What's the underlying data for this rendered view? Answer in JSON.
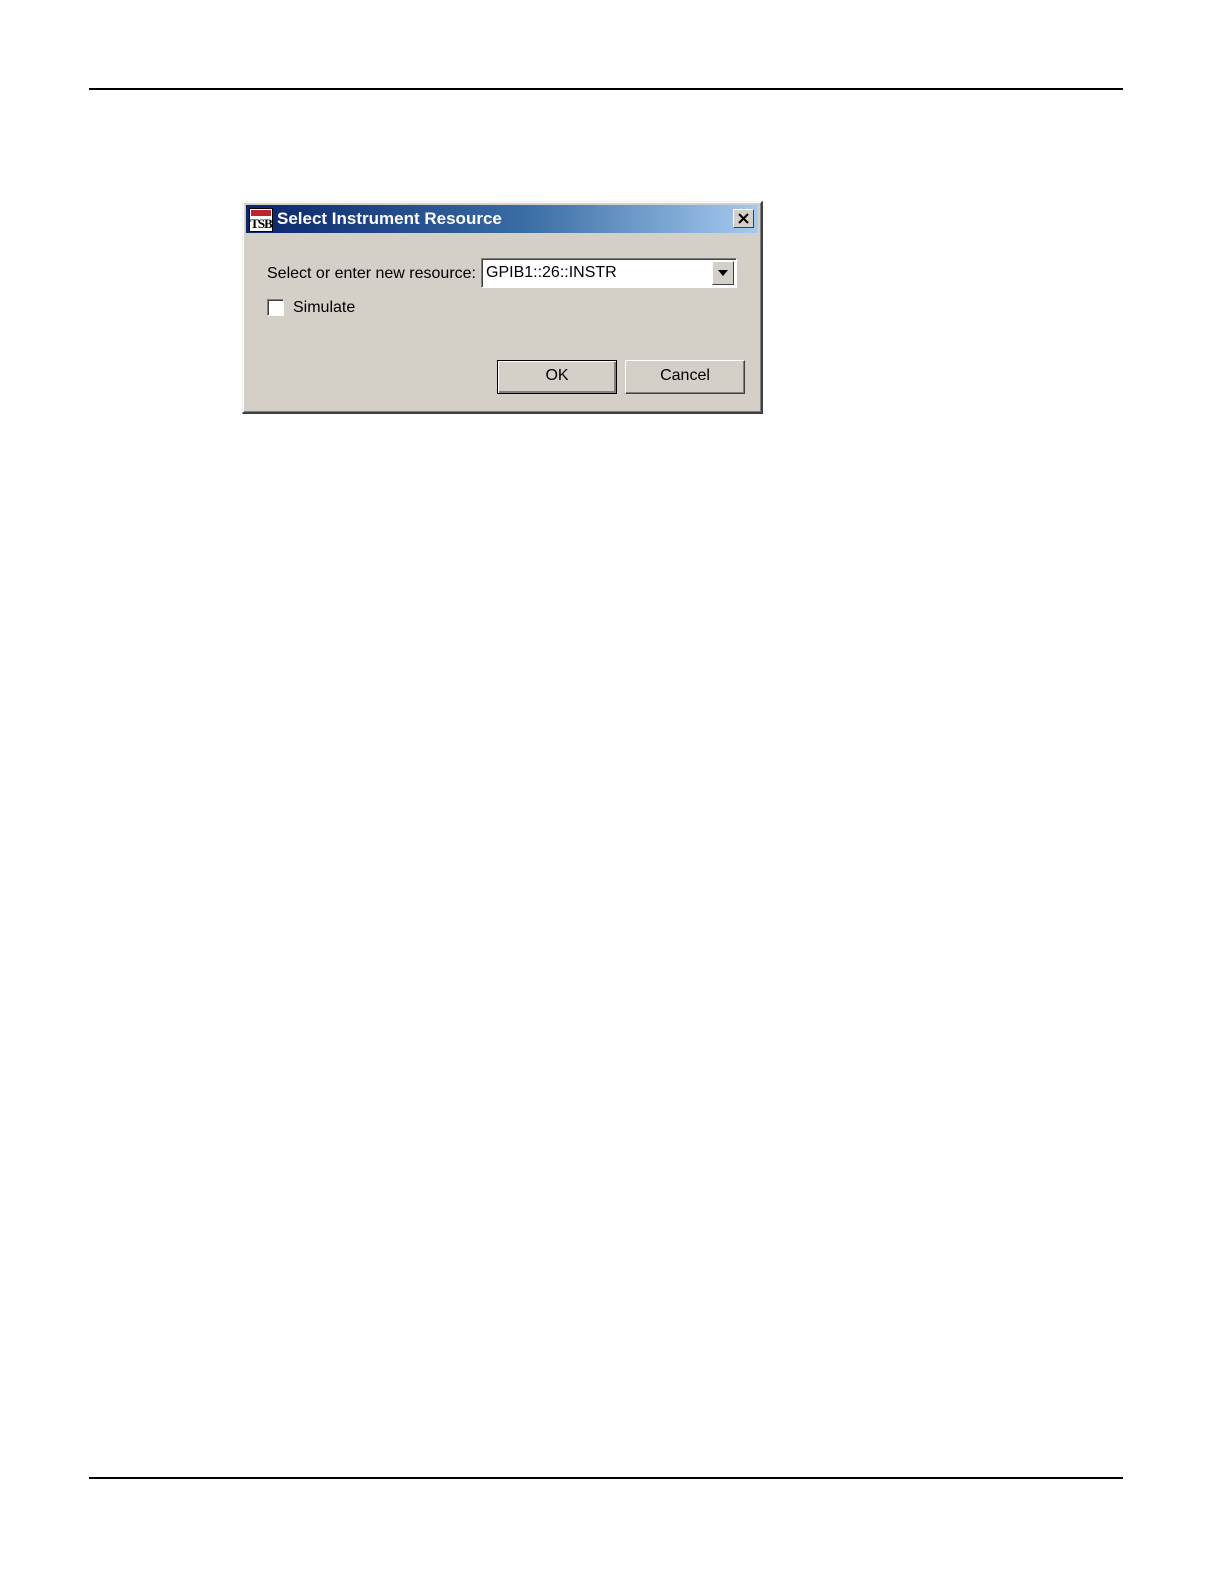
{
  "dialog": {
    "title": "Select Instrument Resource",
    "app_icon_text": "TSB",
    "close_symbol": "close-icon",
    "resource_label": "Select or enter new resource:",
    "resource_value": "GPIB1::26::INSTR",
    "simulate_label": "Simulate",
    "simulate_checked": false,
    "ok_label": "OK",
    "cancel_label": "Cancel"
  },
  "colors": {
    "title_gradient_start": "#0a246a",
    "title_gradient_end": "#a6caf0",
    "dialog_face": "#d4d0c8",
    "icon_accent": "#c0222a"
  }
}
